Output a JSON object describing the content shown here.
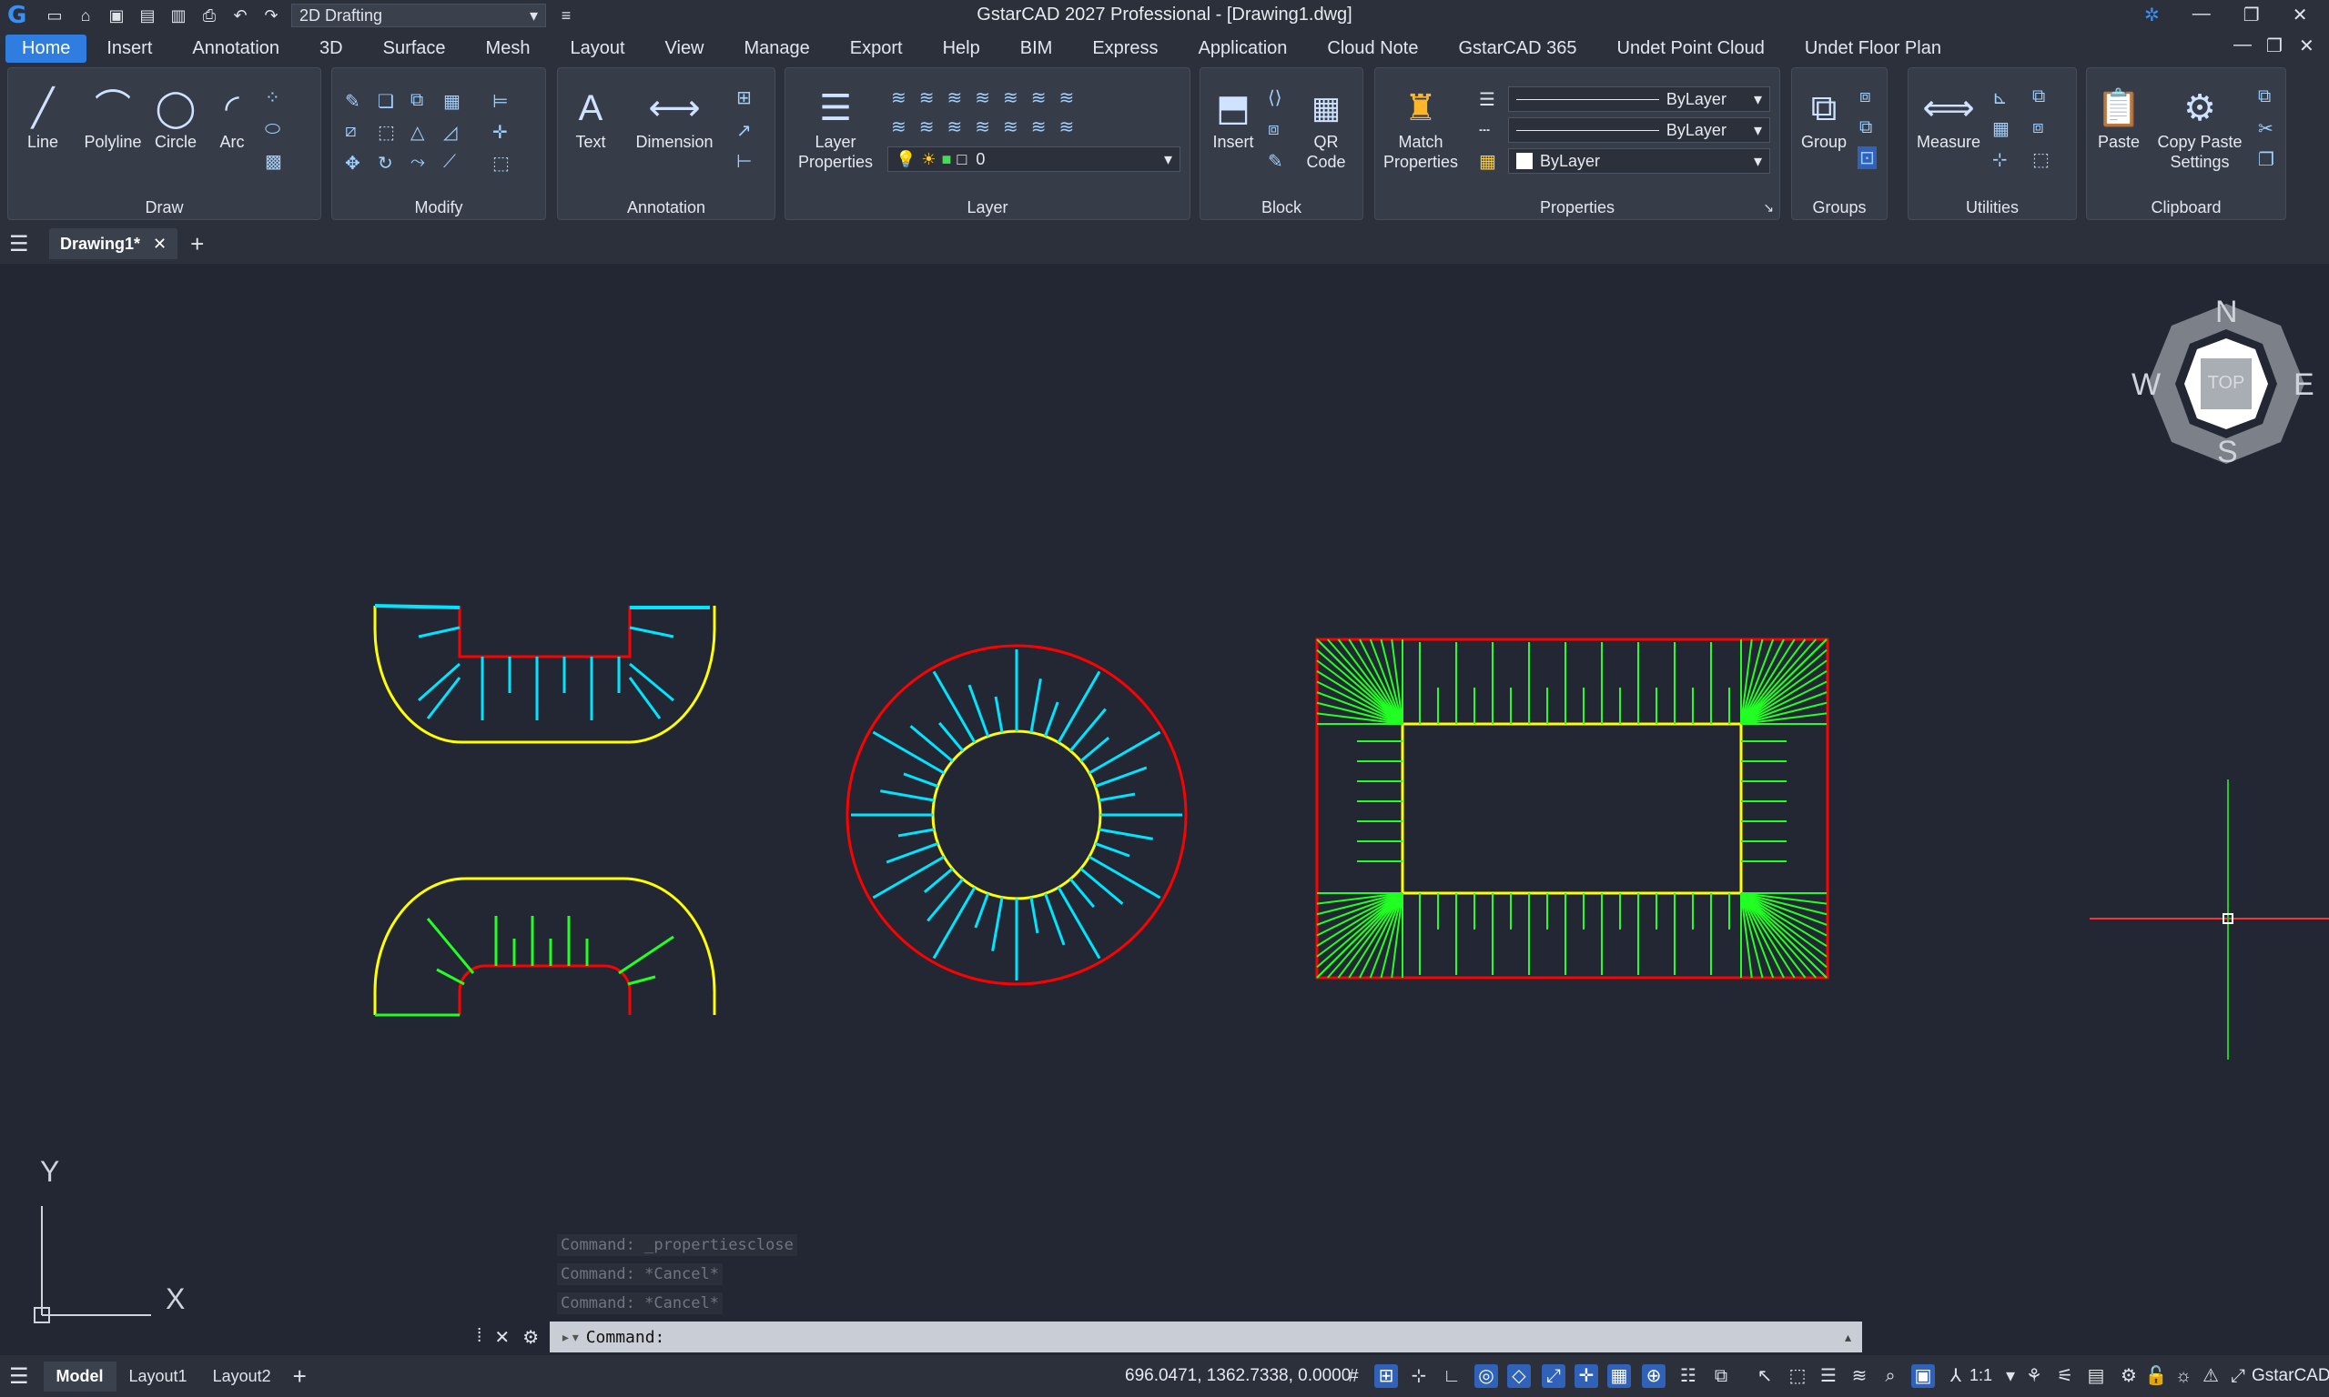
{
  "title": "GstarCAD 2027 Professional - [Drawing1.dwg]",
  "workspace": "2D Drafting",
  "menu_tabs": [
    "Home",
    "Insert",
    "Annotation",
    "3D",
    "Surface",
    "Mesh",
    "Layout",
    "View",
    "Manage",
    "Export",
    "Help",
    "BIM",
    "Express",
    "Application",
    "Cloud Note",
    "GstarCAD 365",
    "Undet Point Cloud",
    "Undet Floor Plan"
  ],
  "ribbon": {
    "draw": {
      "title": "Draw",
      "line": "Line",
      "polyline": "Polyline",
      "circle": "Circle",
      "arc": "Arc"
    },
    "modify": {
      "title": "Modify"
    },
    "annotation": {
      "title": "Annotation",
      "text": "Text",
      "dimension": "Dimension"
    },
    "layer": {
      "title": "Layer",
      "layer_properties_1": "Layer",
      "layer_properties_2": "Properties",
      "current_layer": "0"
    },
    "block": {
      "title": "Block",
      "insert": "Insert",
      "qr_code_1": "QR",
      "qr_code_2": "Code"
    },
    "properties": {
      "title": "Properties",
      "match_1": "Match",
      "match_2": "Properties",
      "linetype": "ByLayer",
      "lineweight": "ByLayer",
      "color": "ByLayer"
    },
    "groups": {
      "title": "Groups",
      "group": "Group"
    },
    "utilities": {
      "title": "Utilities",
      "measure": "Measure"
    },
    "clipboard": {
      "title": "Clipboard",
      "paste": "Paste",
      "copy_paste_1": "Copy Paste",
      "copy_paste_2": "Settings"
    }
  },
  "document_tab": "Drawing1*",
  "viewcube": {
    "n": "N",
    "s": "S",
    "e": "E",
    "w": "W",
    "face": "TOP"
  },
  "ucs": {
    "x": "X",
    "y": "Y"
  },
  "command_history": [
    "Command: _propertiesclose",
    "Command: *Cancel*",
    "Command: *Cancel*"
  ],
  "command_prompt": "Command:",
  "layout_tabs": [
    "Model",
    "Layout1",
    "Layout2"
  ],
  "coordinates": "696.0471, 1362.7338, 0.0000",
  "annotation_scale": "1:1",
  "brand": "GstarCAD",
  "colors": {
    "accent": "#2f7de1",
    "background": "#222733",
    "yellow": "#ffff00",
    "red": "#ff0000",
    "cyan": "#00e5ff",
    "green": "#22ff22"
  }
}
